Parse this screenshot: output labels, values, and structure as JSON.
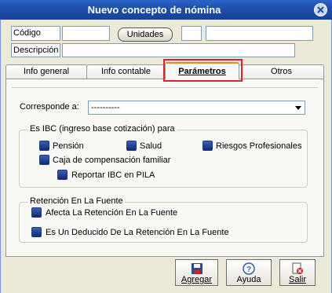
{
  "window": {
    "title": "Nuevo concepto de nómina"
  },
  "header": {
    "codigo_label": "Código",
    "codigo_value": "",
    "unidades_button": "Unidades",
    "unidades_value": "",
    "unidades_desc": "",
    "descripcion_label": "Descripción",
    "descripcion_value": ""
  },
  "tabs": [
    {
      "label": "Info general"
    },
    {
      "label": "Info contable"
    },
    {
      "label": "Parámetros",
      "active": true
    },
    {
      "label": "Otros"
    }
  ],
  "parametros": {
    "corresponde_label": "Corresponde a:",
    "corresponde_value": "----------",
    "ibc_group": {
      "legend": "Es IBC (ingreso base cotización) para",
      "options": [
        "Pensión",
        "Salud",
        "Riesgos Profesionales",
        "Caja de compensación familiar",
        "Reportar IBC en PILA"
      ]
    },
    "retencion_group": {
      "legend": "Retención En La Fuente",
      "options": [
        "Afecta La Retención En La Fuente",
        "Es Un Deducido De La Retención En La Fuente"
      ]
    }
  },
  "toolbar": {
    "agregar_label": "Agregar",
    "ayuda_label": "Ayuda",
    "salir_label": "Salir"
  },
  "colors": {
    "title_bar": "#2d64c8",
    "tab_highlight": "#e0202a",
    "checkbox": "#1c3c78"
  }
}
